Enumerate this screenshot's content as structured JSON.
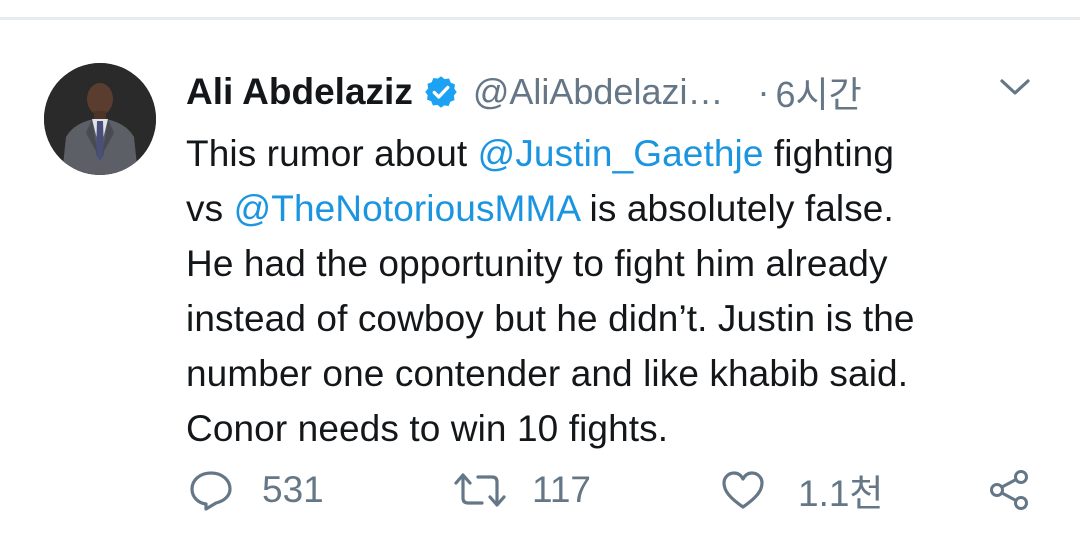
{
  "tweet": {
    "author_name": "Ali Abdelaziz",
    "handle": "@AliAbdelazi…",
    "separator": "·",
    "time": "6시간",
    "body": {
      "line1_text_a": "This rumor about ",
      "line1_mention": "@Justin_Gaethje",
      "line1_text_b": " fighting",
      "line2_text_a": "vs ",
      "line2_mention": "@TheNotoriousMMA",
      "line2_text_b": " is absolutely false.",
      "line3": "He had the opportunity to fight him already",
      "line4": "instead of cowboy but he didn’t. Justin is the",
      "line5": "number one contender and like khabib said.",
      "line6": "Conor needs to win 10 fights."
    },
    "actions": {
      "reply_count": "531",
      "retweet_count": "117",
      "like_count": "1.1천"
    }
  },
  "colors": {
    "text": "#14171a",
    "secondary": "#657786",
    "mention": "#1b95e0",
    "verified": "#1da1f2"
  },
  "icons": [
    "verified-badge-icon",
    "chevron-down-icon",
    "reply-icon",
    "retweet-icon",
    "like-icon",
    "share-icon"
  ]
}
